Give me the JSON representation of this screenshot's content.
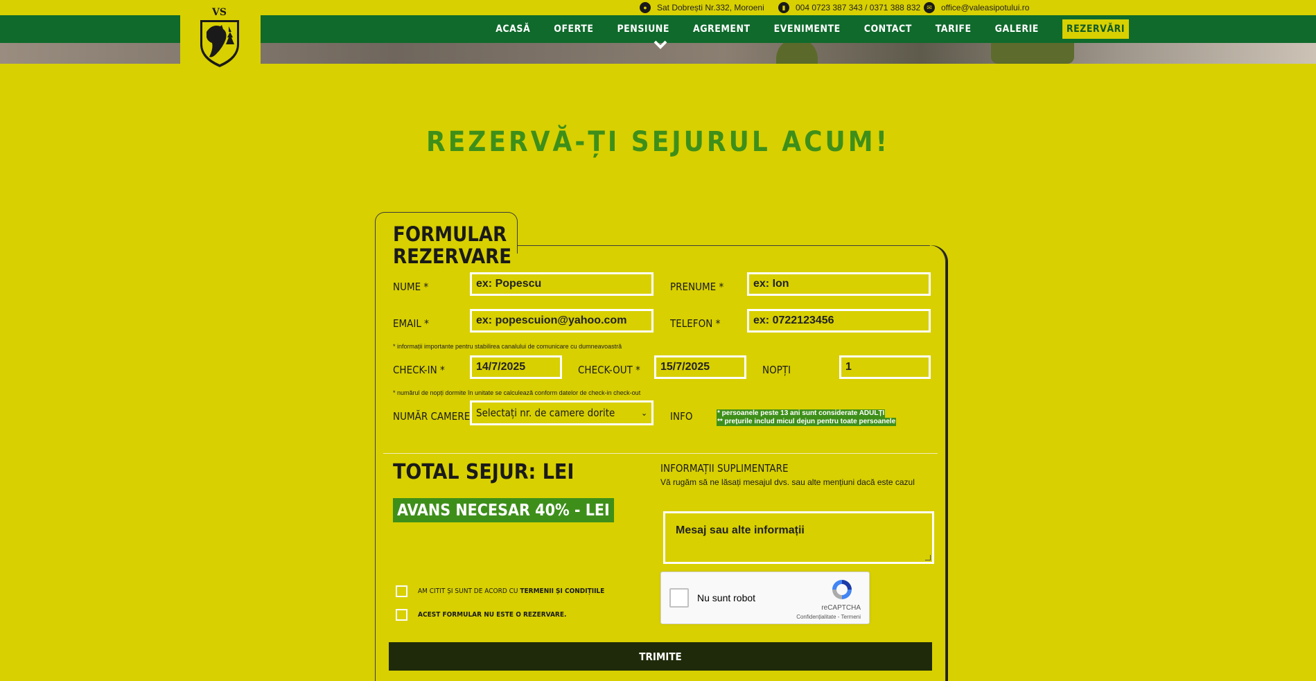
{
  "topbar": {
    "address": "Sat Dobrești Nr.332, Moroeni",
    "phone": "004 0723 387 343 / 0371 388 832",
    "email": "office@valeasipotului.ro"
  },
  "nav": {
    "items": [
      "ACASĂ",
      "OFERTE",
      "PENSIUNE",
      "AGREMENT",
      "EVENIMENTE",
      "CONTACT",
      "TARIFE",
      "GALERIE",
      "REZERVĂRI"
    ]
  },
  "page": {
    "title": "REZERVĂ-ȚI SEJURUL ACUM!"
  },
  "form": {
    "title": "FORMULAR REZERVARE",
    "nume_label": "NUME *",
    "nume_placeholder": "ex: Popescu",
    "prenume_label": "PRENUME *",
    "prenume_placeholder": "ex: Ion",
    "email_label": "EMAIL *",
    "email_placeholder": "ex: popescuion@yahoo.com",
    "telefon_label": "TELEFON *",
    "telefon_placeholder": "ex: 0722123456",
    "note1": "* informații importante pentru stabilirea canalului de comunicare cu dumneavoastră",
    "checkin_label": "CHECK-IN *",
    "checkin_value": "14/7/2025",
    "checkout_label": "CHECK-OUT *",
    "checkout_value": "15/7/2025",
    "nopti_label": "NOPȚI",
    "nopti_value": "1",
    "note2": "* numărul de nopți dormite în unitate se calculează conform datelor de check-in check-out",
    "camere_label": "NUMĂR CAMERE*",
    "camere_select": "Selectați nr. de camere dorite",
    "info_label": "INFO",
    "info_line1": "* persoanele peste 13 ani sunt considerate ADULȚI",
    "info_line2": "** prețurile includ micul dejun pentru toate persoanele",
    "total": "TOTAL SEJUR: LEI",
    "avans": "AVANS NECESAR 40% - LEI",
    "info_sup_title": "INFORMAȚII SUPLIMENTARE",
    "info_sup_sub": "Vă rugăm să ne lăsați mesajul dvs. sau alte mențiuni dacă este cazul",
    "message_placeholder": "Mesaj sau alte informații",
    "terms_prefix": "AM CITIT ȘI SUNT DE ACORD CU ",
    "terms_link": "TERMENII ȘI CONDIȚIILE",
    "not_reservation": "ACEST FORMULAR NU ESTE O REZERVARE.",
    "submit": "TRIMITE"
  },
  "captcha": {
    "label": "Nu sunt robot",
    "brand": "reCAPTCHA",
    "links": "Confidențialitate - Termeni"
  },
  "colors": {
    "background": "#d8d000",
    "nav_green": "#0f6a2c",
    "title_green": "#3e8f1a",
    "submit_bg": "#1f2a0a"
  }
}
